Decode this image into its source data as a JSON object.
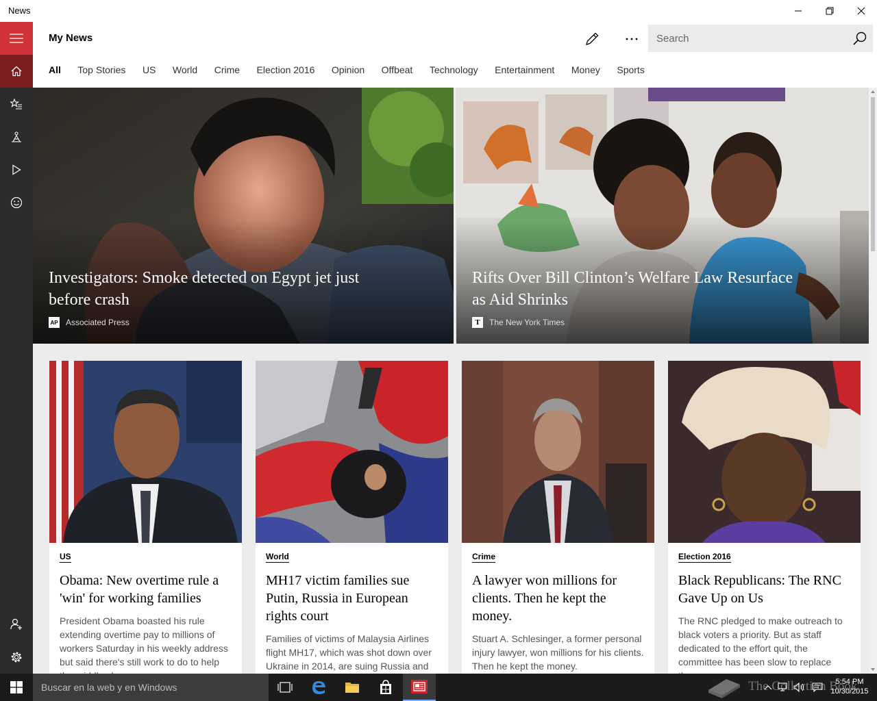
{
  "window": {
    "title": "News"
  },
  "header": {
    "title": "My News",
    "search_placeholder": "Search"
  },
  "tabs": [
    {
      "label": "All"
    },
    {
      "label": "Top Stories"
    },
    {
      "label": "US"
    },
    {
      "label": "World"
    },
    {
      "label": "Crime"
    },
    {
      "label": "Election 2016"
    },
    {
      "label": "Opinion"
    },
    {
      "label": "Offbeat"
    },
    {
      "label": "Technology"
    },
    {
      "label": "Entertainment"
    },
    {
      "label": "Money"
    },
    {
      "label": "Sports"
    }
  ],
  "active_tab": "All",
  "heroes": [
    {
      "headline": "Investigators: Smoke detected on Egypt jet just before crash",
      "source": "Associated Press",
      "source_logo": "AP"
    },
    {
      "headline": "Rifts Over Bill Clinton’s Welfare Law Resurface as Aid Shrinks",
      "source": "The New York Times",
      "source_logo": "T"
    }
  ],
  "cards": [
    {
      "category": "US",
      "title": "Obama: New overtime rule a 'win' for working families",
      "summary": "President Obama boasted his rule extending overtime pay to millions of workers Saturday in his weekly address but said there's still work to do to help the middle class."
    },
    {
      "category": "World",
      "title": "MH17 victim families sue Putin, Russia in European rights court",
      "summary": "Families of victims of Malaysia Airlines flight MH17, which was shot down over Ukraine in 2014, are suing Russia and its president."
    },
    {
      "category": "Crime",
      "title": "A lawyer won millions for clients. Then he kept the money.",
      "summary": "Stuart A. Schlesinger, a former personal injury lawyer, won millions for his clients. Then he kept the money."
    },
    {
      "category": "Election 2016",
      "title": "Black Republicans: The RNC Gave Up on Us",
      "summary": "The RNC pledged to make outreach to black voters a priority. But as staff dedicated to the effort quit, the committee has been slow to replace them."
    }
  ],
  "taskbar": {
    "search_placeholder": "Buscar en la web y en Windows",
    "time": "5:54 PM",
    "date": "10/30/2015",
    "watermark": "The Collection Book"
  },
  "colors": {
    "accent": "#d13438",
    "rail_bg": "#2b2b2b",
    "rail_selected": "#7a1e22",
    "taskbar_bg": "#1b1b1b"
  },
  "icons": {
    "rail": [
      "hamburger-icon",
      "home-icon",
      "star-list-icon",
      "interests-icon",
      "video-icon",
      "smiley-icon",
      "person-add-icon",
      "settings-icon"
    ],
    "toolbar": [
      "edit-icon",
      "more-icon",
      "search-icon"
    ]
  }
}
